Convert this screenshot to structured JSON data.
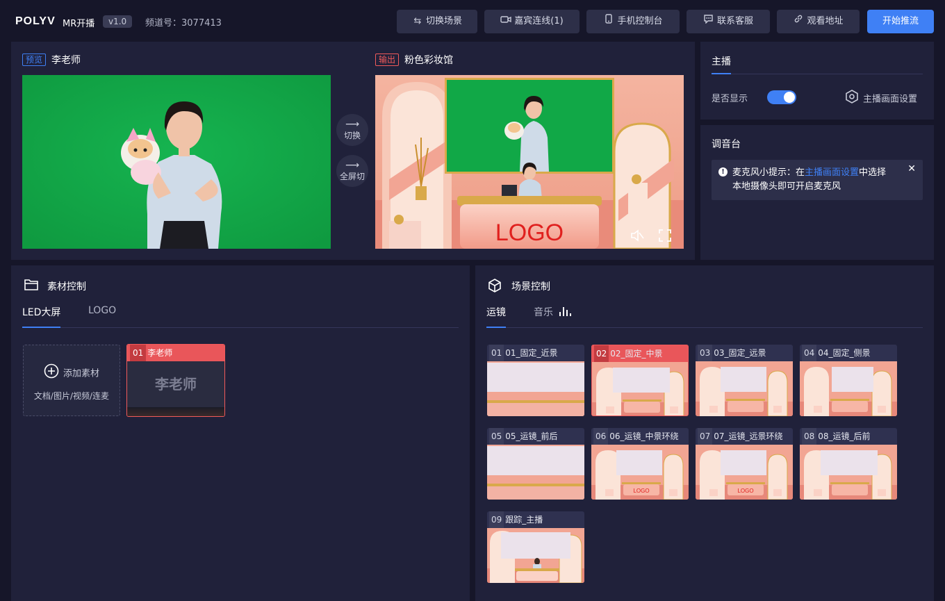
{
  "header": {
    "logo_text": "POLYV",
    "product_name": "MR开播",
    "version": "v1.0",
    "channel_label": "频道号：3077413",
    "buttons": [
      {
        "icon": "swap-icon",
        "label": "切换场景"
      },
      {
        "icon": "camera-icon",
        "label": "嘉宾连线(1)"
      },
      {
        "icon": "phone-icon",
        "label": "手机控制台"
      },
      {
        "icon": "chat-icon",
        "label": "联系客服"
      },
      {
        "icon": "link-icon",
        "label": "观看地址"
      }
    ],
    "start_button": "开始推流"
  },
  "preview": {
    "tag": "预览",
    "name": "李老师"
  },
  "output": {
    "tag": "输出",
    "name": "粉色彩妆馆",
    "logo_text": "LOGO",
    "icons": [
      "mute-icon",
      "fullscreen-icon"
    ]
  },
  "switch_controls": {
    "switch_label": "切换",
    "fullscreen_switch_label": "全屏切"
  },
  "host": {
    "title": "主播",
    "display_label": "是否显示",
    "display_on": true,
    "settings_label": "主播画面设置"
  },
  "mixer": {
    "title": "调音台",
    "tip_prefix": "麦克风小提示：在",
    "tip_link": "主播画面设置",
    "tip_suffix": "中选择",
    "tip_line2": "本地摄像头即可开启麦克风"
  },
  "material": {
    "title": "素材控制",
    "tabs": [
      "LED大屏",
      "LOGO"
    ],
    "active_tab": "LED大屏",
    "add_label": "添加素材",
    "add_hint": "文档/图片/视频/连麦",
    "items": [
      {
        "num": "01",
        "title": "李老师",
        "preview_text": "李老师"
      }
    ]
  },
  "scene": {
    "title": "场景控制",
    "tabs": [
      "运镜",
      "音乐"
    ],
    "active_tab": "运镜",
    "selected": "02",
    "items": [
      {
        "num": "01",
        "title": "01_固定_近景"
      },
      {
        "num": "02",
        "title": "02_固定_中景"
      },
      {
        "num": "03",
        "title": "03_固定_远景"
      },
      {
        "num": "04",
        "title": "04_固定_侧景"
      },
      {
        "num": "05",
        "title": "05_运镜_前后"
      },
      {
        "num": "06",
        "title": "06_运镜_中景环绕"
      },
      {
        "num": "07",
        "title": "07_运镜_远景环绕"
      },
      {
        "num": "08",
        "title": "08_运镜_后前"
      },
      {
        "num": "09",
        "title": "跟踪_主播"
      }
    ],
    "thumb_logo": "LOGO"
  },
  "colors": {
    "accent": "#3f80f5",
    "danger": "#e9565a",
    "green_screen": "#12a94a",
    "studio_pink": "#f2a593"
  }
}
